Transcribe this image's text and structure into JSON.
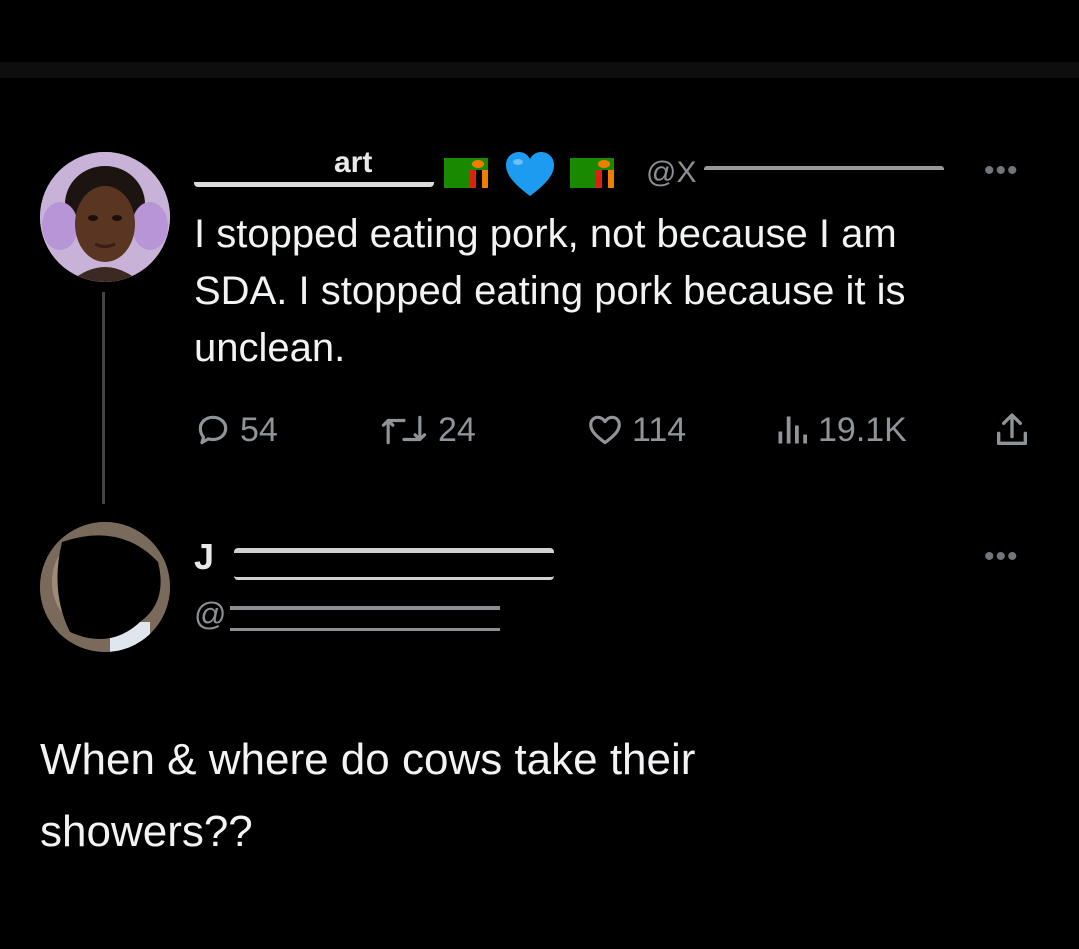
{
  "tweet": {
    "author_name": "art",
    "handle_prefix": "@X",
    "text": "I stopped eating pork, not because I am\nSDA. I stopped eating pork because it is\nunclean.",
    "more_label": "•••",
    "stats": {
      "replies": "54",
      "retweets": "24",
      "likes": "114",
      "views": "19.1K"
    },
    "icons": [
      "zambia-flag-icon",
      "blue-heart-icon",
      "zambia-flag-icon",
      "reply-icon",
      "retweet-icon",
      "like-icon",
      "views-icon",
      "share-icon",
      "more-icon"
    ]
  },
  "reply": {
    "author_name": "J",
    "handle_prefix": "@",
    "more_label": "•••",
    "text": "When & where do cows take their\nshowers??"
  },
  "colors": {
    "background": "#000000",
    "text": "#e7e9ea",
    "muted": "#71767b",
    "heart": "#1d9bf0",
    "flag_green": "#198a00"
  }
}
